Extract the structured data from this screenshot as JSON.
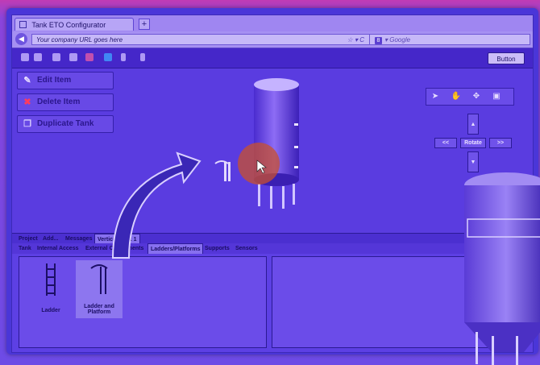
{
  "browser": {
    "tab_title": "Tank ETO Configurator",
    "new_tab": "+",
    "url": "Your company URL goes here",
    "search_placeholder": "Google",
    "search_engine_badge": "8"
  },
  "toolbar": {
    "button_label": "Button",
    "icons": [
      "folder-icon",
      "save-icon",
      "print-icon",
      "people-icon",
      "pdf-icon",
      "info-icon",
      "download-icon",
      "upload-icon"
    ]
  },
  "actions": {
    "edit_label": "Edit Item",
    "delete_label": "Delete Item",
    "duplicate_label": "Duplicate Tank"
  },
  "view_tools": {
    "icons": [
      "pointer-icon",
      "hand-icon",
      "move-icon",
      "camera-icon"
    ],
    "up": "▲",
    "down": "▼",
    "left": "<<",
    "right": ">>",
    "rotate": "Rotate"
  },
  "top_tabs": [
    "Project",
    "Add...",
    "Messages",
    "Vertical Tank 1"
  ],
  "sub_tabs": [
    "Tank",
    "Internal Access",
    "External Components",
    "Ladders/Platforms",
    "Supports",
    "Sensors"
  ],
  "items": [
    {
      "label": "Ladder"
    },
    {
      "label": "Ladder and Platform"
    }
  ],
  "colors": {
    "overlay": "#6d4be6",
    "accent": "#4527c9",
    "highlight_circle": "#c8502d"
  }
}
